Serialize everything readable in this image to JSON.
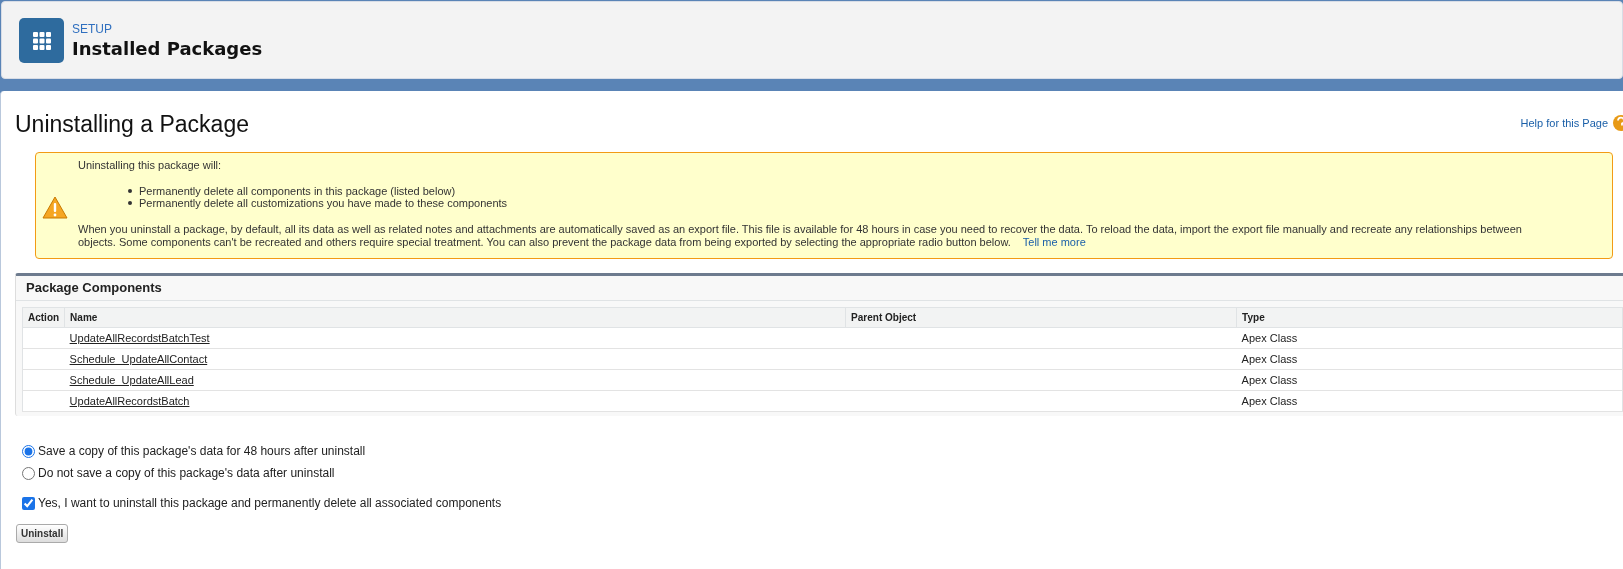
{
  "header": {
    "eyebrow": "SETUP",
    "title": "Installed Packages"
  },
  "page": {
    "title": "Uninstalling a Package",
    "help_link": "Help for this Page"
  },
  "warning": {
    "intro": "Uninstalling this package will:",
    "bullets": [
      "Permanently delete all components in this package (listed below)",
      "Permanently delete all customizations you have made to these components"
    ],
    "body": "When you uninstall a package, by default, all its data as well as related notes and attachments are automatically saved as an export file. This file is available for 48 hours in case you need to recover the data. To reload the data, import the export file manually and recreate any relationships between objects. Some components can't be recreated and others require special treatment. You can also prevent the package data from being exported by selecting the appropriate radio button below.",
    "link": "Tell me more"
  },
  "components": {
    "title": "Package Components",
    "columns": [
      "Action",
      "Name",
      "Parent Object",
      "Type"
    ],
    "rows": [
      {
        "name": "UpdateAllRecordstBatchTest",
        "type": "Apex Class"
      },
      {
        "name": "Schedule_UpdateAllContact",
        "type": "Apex Class"
      },
      {
        "name": "Schedule_UpdateAllLead",
        "type": "Apex Class"
      },
      {
        "name": "UpdateAllRecordstBatch",
        "type": "Apex Class"
      }
    ]
  },
  "options": [
    {
      "kind": "radio",
      "label": "Save a copy of this package's data for 48 hours after uninstall",
      "selected": true
    },
    {
      "kind": "radio",
      "label": "Do not save a copy of this package's data after uninstall",
      "selected": false
    },
    {
      "kind": "checkbox",
      "label": "Yes, I want to uninstall this package and permanently delete all associated components",
      "checked": true
    }
  ],
  "button": "Uninstall"
}
